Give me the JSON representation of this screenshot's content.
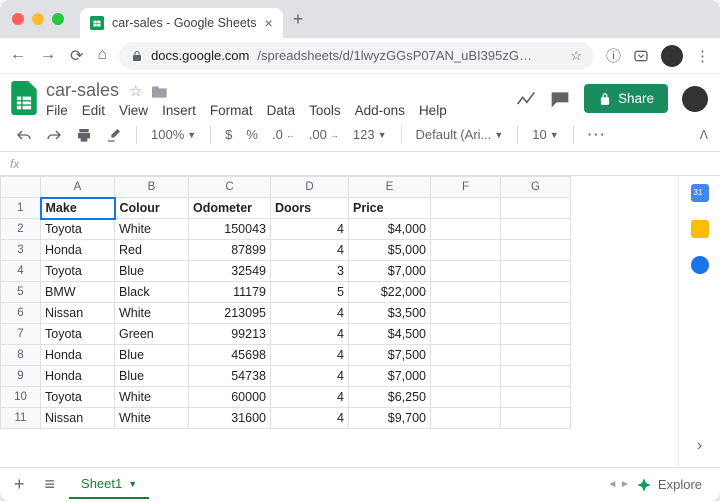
{
  "browser": {
    "tab_title": "car-sales - Google Sheets",
    "url_prefix": "docs.google.com",
    "url_path": "/spreadsheets/d/1lwyzGGsP07AN_uBI395zG…"
  },
  "doc": {
    "title": "car-sales",
    "menus": [
      "File",
      "Edit",
      "View",
      "Insert",
      "Format",
      "Data",
      "Tools",
      "Add-ons",
      "Help"
    ]
  },
  "share_label": "Share",
  "toolbar": {
    "zoom": "100%",
    "currency": "$",
    "percent": "%",
    "dec_dec": ".0",
    "dec_inc": ".00",
    "format_menu": "123",
    "font": "Default (Ari...",
    "font_size": "10"
  },
  "formula_bar": {
    "fx_label": "fx"
  },
  "columns": [
    "A",
    "B",
    "C",
    "D",
    "E",
    "F",
    "G"
  ],
  "headers": [
    "Make",
    "Colour",
    "Odometer",
    "Doors",
    "Price"
  ],
  "rows": [
    {
      "make": "Toyota",
      "colour": "White",
      "odometer": "150043",
      "doors": "4",
      "price": "$4,000"
    },
    {
      "make": "Honda",
      "colour": "Red",
      "odometer": "87899",
      "doors": "4",
      "price": "$5,000"
    },
    {
      "make": "Toyota",
      "colour": "Blue",
      "odometer": "32549",
      "doors": "3",
      "price": "$7,000"
    },
    {
      "make": "BMW",
      "colour": "Black",
      "odometer": "11179",
      "doors": "5",
      "price": "$22,000"
    },
    {
      "make": "Nissan",
      "colour": "White",
      "odometer": "213095",
      "doors": "4",
      "price": "$3,500"
    },
    {
      "make": "Toyota",
      "colour": "Green",
      "odometer": "99213",
      "doors": "4",
      "price": "$4,500"
    },
    {
      "make": "Honda",
      "colour": "Blue",
      "odometer": "45698",
      "doors": "4",
      "price": "$7,500"
    },
    {
      "make": "Honda",
      "colour": "Blue",
      "odometer": "54738",
      "doors": "4",
      "price": "$7,000"
    },
    {
      "make": "Toyota",
      "colour": "White",
      "odometer": "60000",
      "doors": "4",
      "price": "$6,250"
    },
    {
      "make": "Nissan",
      "colour": "White",
      "odometer": "31600",
      "doors": "4",
      "price": "$9,700"
    }
  ],
  "sheet_tab": "Sheet1",
  "explore_label": "Explore",
  "chart_data": {
    "type": "table",
    "columns": [
      "Make",
      "Colour",
      "Odometer",
      "Doors",
      "Price"
    ],
    "data": [
      [
        "Toyota",
        "White",
        150043,
        4,
        4000
      ],
      [
        "Honda",
        "Red",
        87899,
        4,
        5000
      ],
      [
        "Toyota",
        "Blue",
        32549,
        3,
        7000
      ],
      [
        "BMW",
        "Black",
        11179,
        5,
        22000
      ],
      [
        "Nissan",
        "White",
        213095,
        4,
        3500
      ],
      [
        "Toyota",
        "Green",
        99213,
        4,
        4500
      ],
      [
        "Honda",
        "Blue",
        45698,
        4,
        7500
      ],
      [
        "Honda",
        "Blue",
        54738,
        4,
        7000
      ],
      [
        "Toyota",
        "White",
        60000,
        4,
        6250
      ],
      [
        "Nissan",
        "White",
        31600,
        4,
        9700
      ]
    ]
  }
}
